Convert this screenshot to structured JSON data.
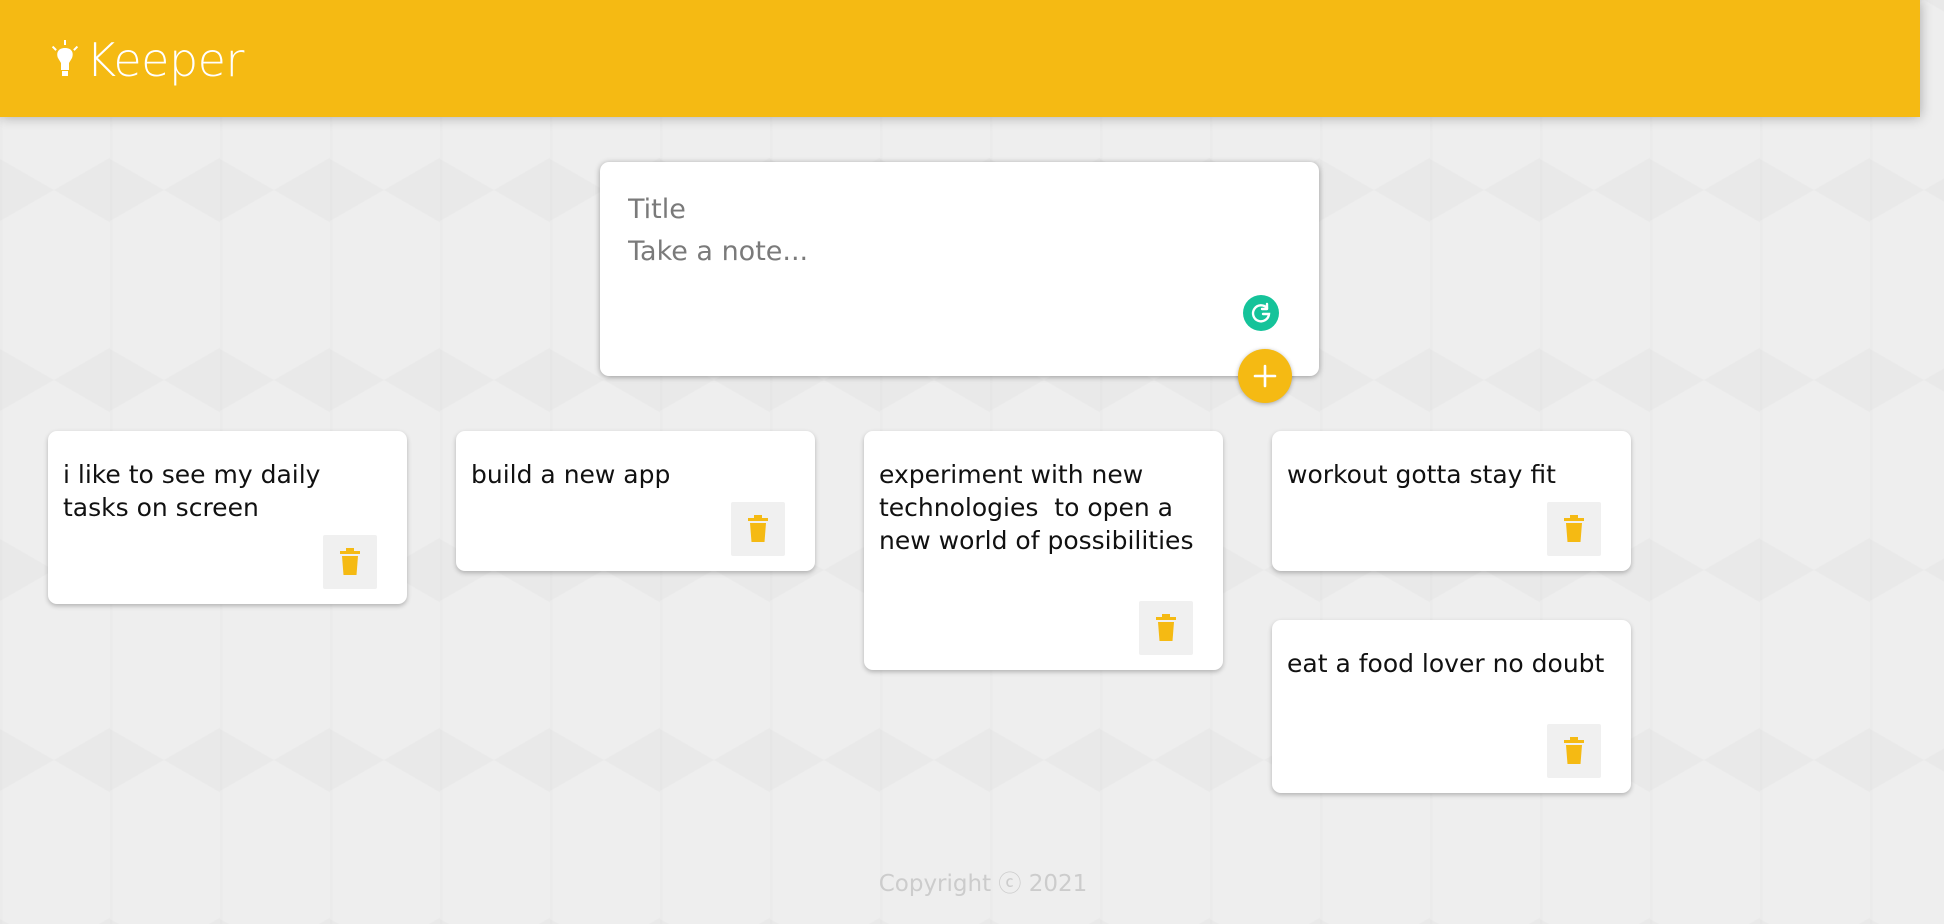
{
  "header": {
    "app_name": "Keeper",
    "logo_icon": "lightbulb-icon",
    "accent_color": "#f5ba13"
  },
  "create_area": {
    "title_placeholder": "Title",
    "content_placeholder": "Take a note...",
    "assistant_icon": "grammarly-icon",
    "add_icon": "plus-icon"
  },
  "notes": [
    {
      "text": "i like to see my daily tasks on screen",
      "delete_icon": "trash-icon"
    },
    {
      "text": "build a new app",
      "delete_icon": "trash-icon"
    },
    {
      "text": "experiment with new technologies  to open a new world of possibilities",
      "delete_icon": "trash-icon"
    },
    {
      "text": "workout gotta stay fit",
      "delete_icon": "trash-icon"
    },
    {
      "text": "eat a food lover no doubt",
      "delete_icon": "trash-icon"
    }
  ],
  "footer": {
    "copyright": "Copyright ⓒ 2021"
  }
}
